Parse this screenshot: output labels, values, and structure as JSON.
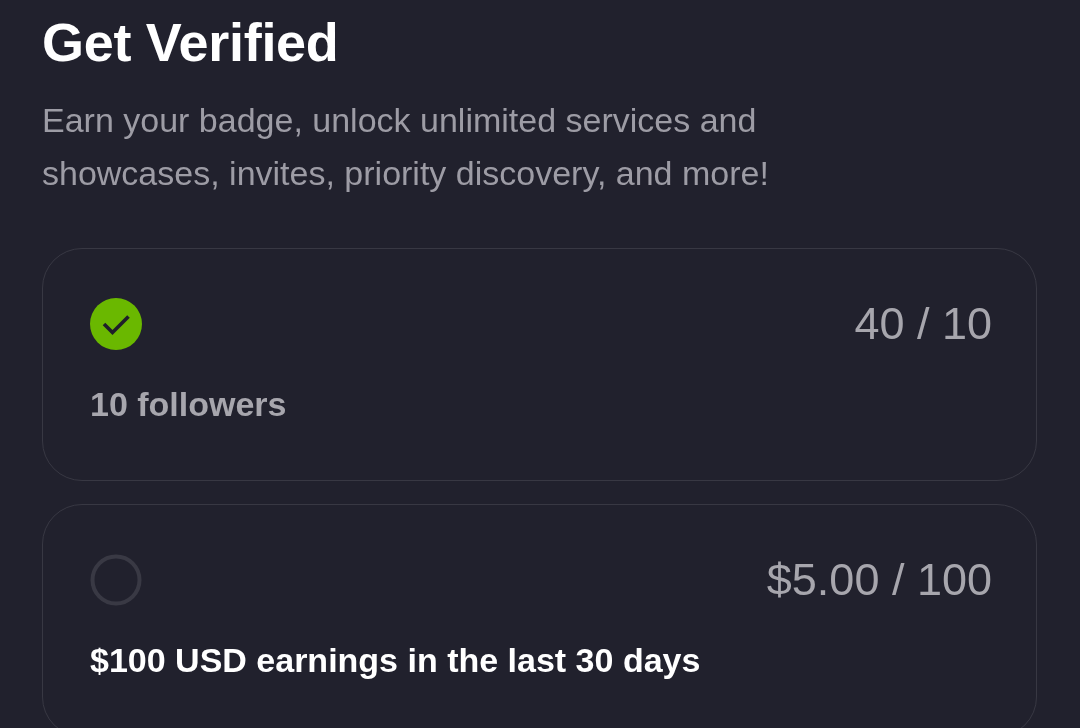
{
  "header": {
    "title": "Get Verified",
    "subtitle": "Earn your badge, unlock unlimited services and showcases, invites, priority discovery, and more!"
  },
  "requirements": [
    {
      "completed": true,
      "progress": "40 / 10",
      "label": "10 followers"
    },
    {
      "completed": false,
      "progress": "$5.00 / 100",
      "label": "$100 USD earnings in the last 30 days"
    }
  ]
}
